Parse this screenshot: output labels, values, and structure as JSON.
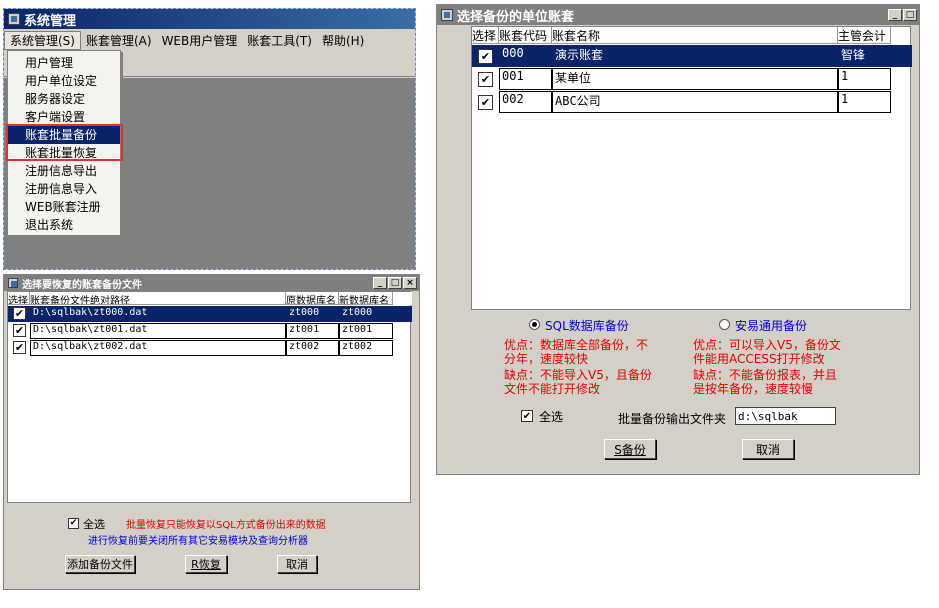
{
  "main_window": {
    "title": "系统管理",
    "menu": [
      "系统管理(S)",
      "账套管理(A)",
      "WEB用户管理",
      "账套工具(T)",
      "帮助(H)"
    ],
    "dropdown": [
      "用户管理",
      "用户单位设定",
      "服务器设定",
      "客户端设置",
      "账套批量备份",
      "账套批量恢复",
      "注册信息导出",
      "注册信息导入",
      "WEB账套注册",
      "退出系统"
    ],
    "highlighted_item": "账套批量备份",
    "annotation_color": "#e03030"
  },
  "restore_dialog": {
    "title": "选择要恢复的账套备份文件",
    "columns": [
      "选择",
      "账套备份文件绝对路径",
      "原数据库名",
      "新数据库名"
    ],
    "rows": [
      {
        "path": "D:\\sqlbak\\zt000.dat",
        "orig_db": "zt000",
        "new_db": "zt000",
        "checked": true
      },
      {
        "path": "D:\\sqlbak\\zt001.dat",
        "orig_db": "zt001",
        "new_db": "zt001",
        "checked": true
      },
      {
        "path": "D:\\sqlbak\\zt002.dat",
        "orig_db": "zt002",
        "new_db": "zt002",
        "checked": true
      }
    ],
    "select_all_label": "全选",
    "note1": "批量恢复只能恢复以SQL方式备份出来的数据",
    "note2": "进行恢复前要关闭所有其它安易模块及查询分析器",
    "buttons": {
      "add": "添加备份文件",
      "restore": "R恢复",
      "cancel": "取消"
    }
  },
  "backup_dialog": {
    "title": "选择备份的单位账套",
    "columns": [
      "选择",
      "账套代码",
      "账套名称",
      "主管会计"
    ],
    "rows": [
      {
        "code": "000",
        "name": "演示账套",
        "accountant": "智锋",
        "checked": true
      },
      {
        "code": "001",
        "name": "某单位",
        "accountant": "1",
        "checked": true
      },
      {
        "code": "002",
        "name": "ABC公司",
        "accountant": "1",
        "checked": true
      }
    ],
    "option_sql": "SQL数据库备份",
    "option_general": "安易通用备份",
    "sql_pros": "优点：数据库全部备份，不分年，速度较快",
    "sql_cons": "缺点：不能导入V5，且备份文件不能打开修改",
    "gen_pros": "优点：可以导入V5，备份文件能用ACCESS打开修改",
    "gen_cons": "缺点：不能备份报表，并且是按年备份，速度较慢",
    "select_all_label": "全选",
    "folder_label": "批量备份输出文件夹",
    "folder_value": "d:\\sqlbak",
    "buttons": {
      "backup": "S备份",
      "cancel": "取消"
    }
  }
}
